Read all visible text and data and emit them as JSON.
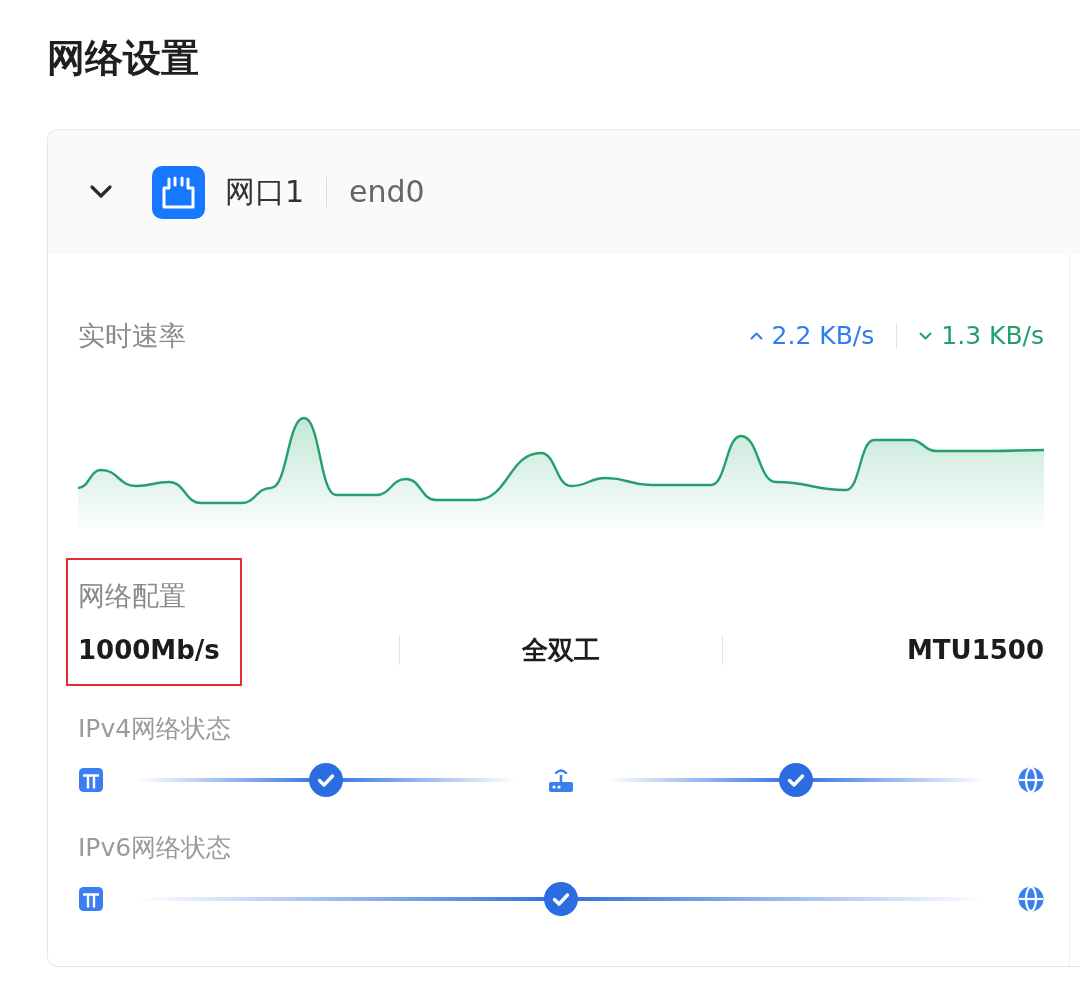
{
  "page": {
    "title": "网络设置"
  },
  "port": {
    "name": "网口1",
    "interface": "end0",
    "expanded": true
  },
  "speed": {
    "label": "实时速率",
    "upload": "2.2 KB/s",
    "download": "1.3 KB/s"
  },
  "network_config": {
    "label": "网络配置",
    "highlighted": true,
    "values": [
      "1000Mb/s",
      "全双工",
      "MTU1500"
    ]
  },
  "status_rows": [
    {
      "label": "IPv4网络状态",
      "path": [
        {
          "kind": "device"
        },
        {
          "kind": "link",
          "connected": true
        },
        {
          "kind": "router"
        },
        {
          "kind": "link",
          "connected": true
        },
        {
          "kind": "internet"
        }
      ]
    },
    {
      "label": "IPv6网络状态",
      "path": [
        {
          "kind": "device"
        },
        {
          "kind": "link",
          "connected": true
        },
        {
          "kind": "internet"
        }
      ]
    }
  ]
}
